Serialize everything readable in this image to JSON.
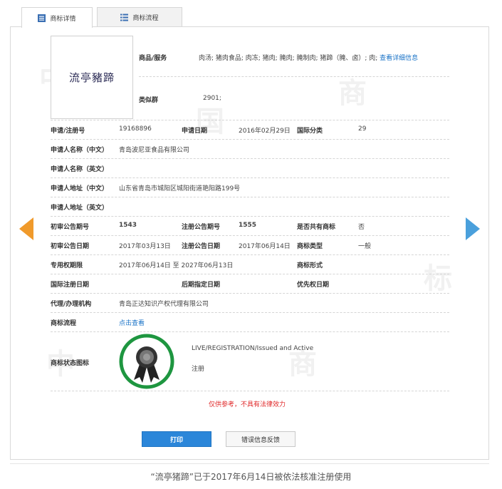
{
  "tabs": [
    {
      "label": "商标详情",
      "icon": "list-icon",
      "active": true
    },
    {
      "label": "商标流程",
      "icon": "grid-list-icon",
      "active": false
    }
  ],
  "watermark": [
    "中",
    "国",
    "商",
    "标"
  ],
  "logo": {
    "text": "流亭豬蹄"
  },
  "goods": {
    "label": "商品/服务",
    "value": "肉汤; 猪肉食品; 肉冻; 猪肉; 腌肉; 腌制肉; 猪蹄（腌、卤）; 肉;",
    "link": "查看详细信息"
  },
  "similar_group": {
    "label": "类似群",
    "value": "2901;"
  },
  "application_no": {
    "label": "申请/注册号",
    "value": "19168896"
  },
  "application_date": {
    "label": "申请日期",
    "value": "2016年02月29日"
  },
  "intl_class": {
    "label": "国际分类",
    "value": "29"
  },
  "applicant_cn": {
    "label": "申请人名称（中文）",
    "value": "青岛波尼亚食品有限公司"
  },
  "applicant_en": {
    "label": "申请人名称（英文）",
    "value": ""
  },
  "address_cn": {
    "label": "申请人地址（中文）",
    "value": "山东省青岛市城阳区城阳街道艳阳路199号"
  },
  "address_en": {
    "label": "申请人地址（英文）",
    "value": ""
  },
  "prelim_issue": {
    "label": "初审公告期号",
    "value": "1543"
  },
  "reg_issue": {
    "label": "注册公告期号",
    "value": "1555"
  },
  "shared": {
    "label": "是否共有商标",
    "value": "否"
  },
  "prelim_date": {
    "label": "初审公告日期",
    "value": "2017年03月13日"
  },
  "reg_date": {
    "label": "注册公告日期",
    "value": "2017年06月14日"
  },
  "tm_type": {
    "label": "商标类型",
    "value": "一般"
  },
  "exclusive_period": {
    "label": "专用权期限",
    "value": "2017年06月14日 至 2027年06月13日"
  },
  "tm_form": {
    "label": "商标形式",
    "value": ""
  },
  "intl_reg_date": {
    "label": "国际注册日期",
    "value": ""
  },
  "later_date": {
    "label": "后期指定日期",
    "value": ""
  },
  "priority_date": {
    "label": "优先权日期",
    "value": ""
  },
  "agent": {
    "label": "代理/办理机构",
    "value": "青岛正达知识产权代理有限公司"
  },
  "flow": {
    "label": "商标流程",
    "link": "点击查看"
  },
  "status": {
    "label": "商标状态图标",
    "en": "LIVE/REGISTRATION/Issued and Active",
    "cn": "注册"
  },
  "disclaimer": "仅供参考，不具有法律效力",
  "buttons": {
    "print": "打印",
    "report": "错误信息反馈"
  },
  "caption": "“流亭猪蹄”已于2017年6月14日被依法核准注册使用",
  "colors": {
    "accent_blue": "#2b86d9",
    "link": "#1a73c7",
    "warning_red": "#e0292a",
    "arrow_left": "#f09a2b",
    "arrow_right": "#4aa0dc",
    "badge_ring": "#1e9640"
  }
}
